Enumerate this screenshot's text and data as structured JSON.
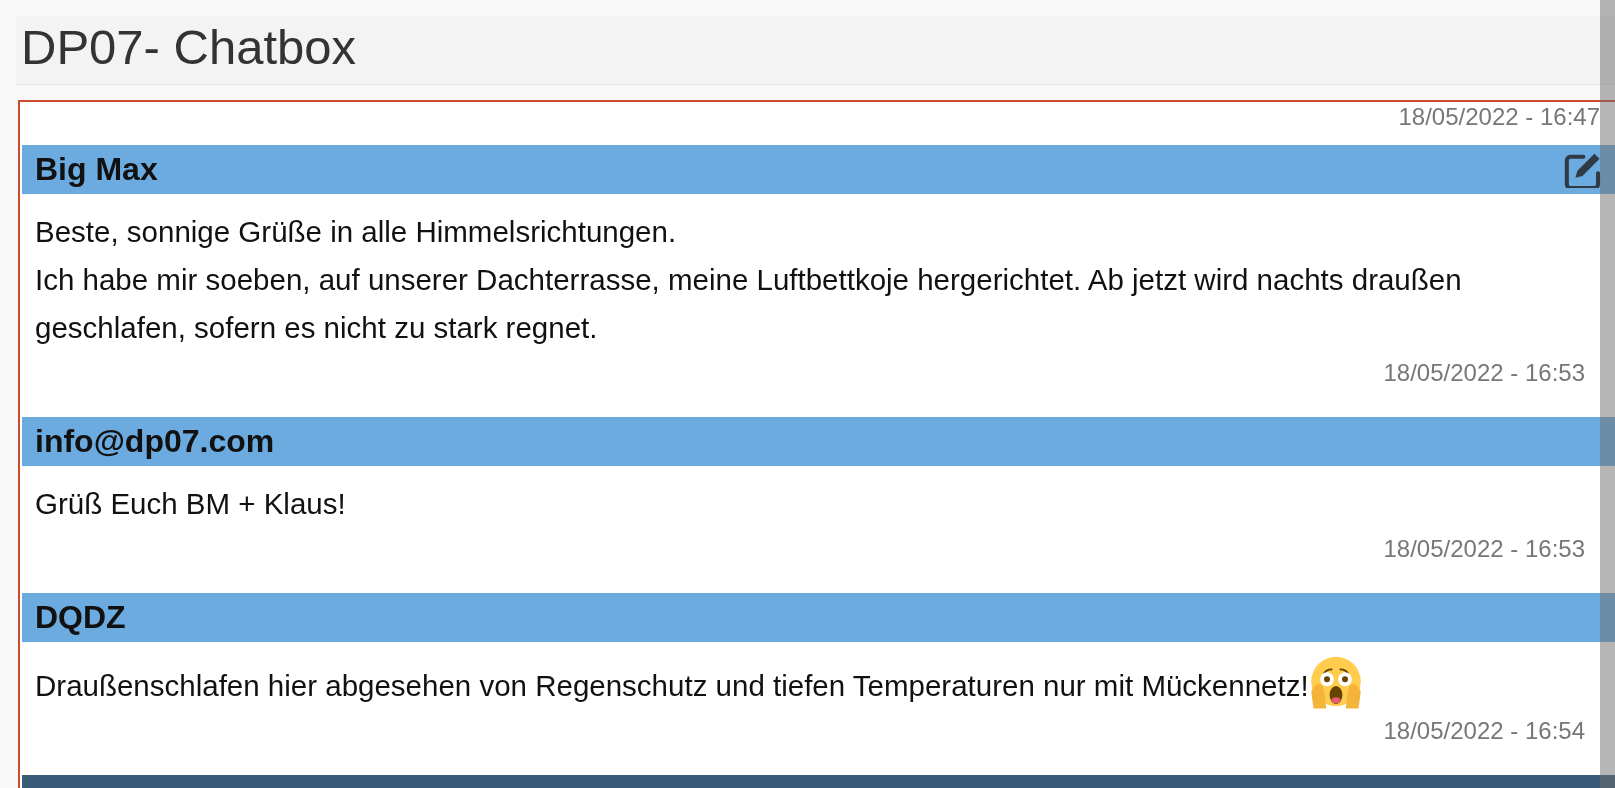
{
  "page": {
    "title": "DP07- Chatbox"
  },
  "chat": {
    "previous_timestamp": "18/05/2022 - 16:47",
    "messages": [
      {
        "author": "Big Max",
        "editable": true,
        "highlighted": false,
        "text": "Beste, sonnige Grüße in alle Himmelsrichtungen.\nIch habe mir soeben, auf unserer Dachterrasse, meine Luftbettkoje hergerichtet. Ab jetzt wird nachts draußen geschlafen, sofern es nicht zu stark regnet.",
        "emoji": false,
        "timestamp": "18/05/2022 - 16:53"
      },
      {
        "author": "info@dp07.com",
        "editable": false,
        "highlighted": false,
        "text": "Grüß Euch BM + Klaus!",
        "emoji": false,
        "timestamp": "18/05/2022 - 16:53"
      },
      {
        "author": "DQDZ",
        "editable": false,
        "highlighted": false,
        "text": "Draußenschlafen hier abgesehen von Regenschutz und tiefen Temperaturen nur mit Mückennetz!",
        "emoji": true,
        "timestamp": "18/05/2022 - 16:54"
      },
      {
        "editable": false,
        "highlighted": true
      }
    ]
  }
}
